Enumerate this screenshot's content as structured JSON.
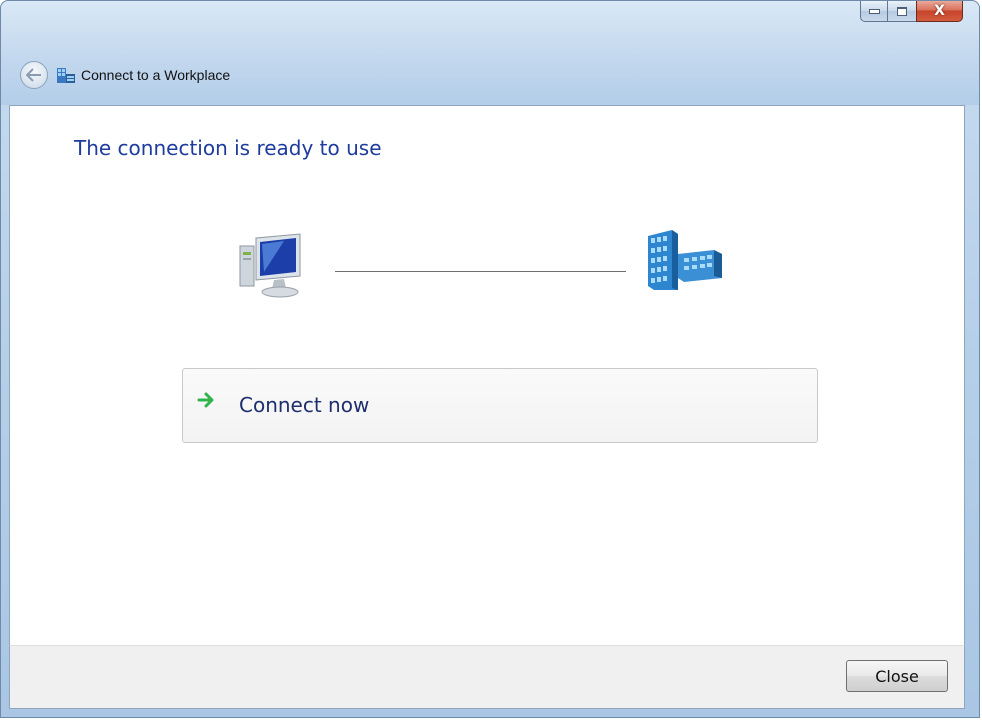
{
  "window": {
    "title": "Connect to a Workplace",
    "caption_buttons": {
      "minimize_icon": "minimize-icon",
      "maximize_icon": "maximize-icon",
      "close_glyph": "X"
    }
  },
  "main": {
    "heading": "The connection is ready to use",
    "command_link": {
      "label": "Connect now",
      "icon": "green-arrow-icon"
    }
  },
  "footer": {
    "close_label": "Close"
  },
  "colors": {
    "heading": "#1e3b9e",
    "command_text": "#1f2f6e",
    "arrow": "#2fb34a"
  }
}
